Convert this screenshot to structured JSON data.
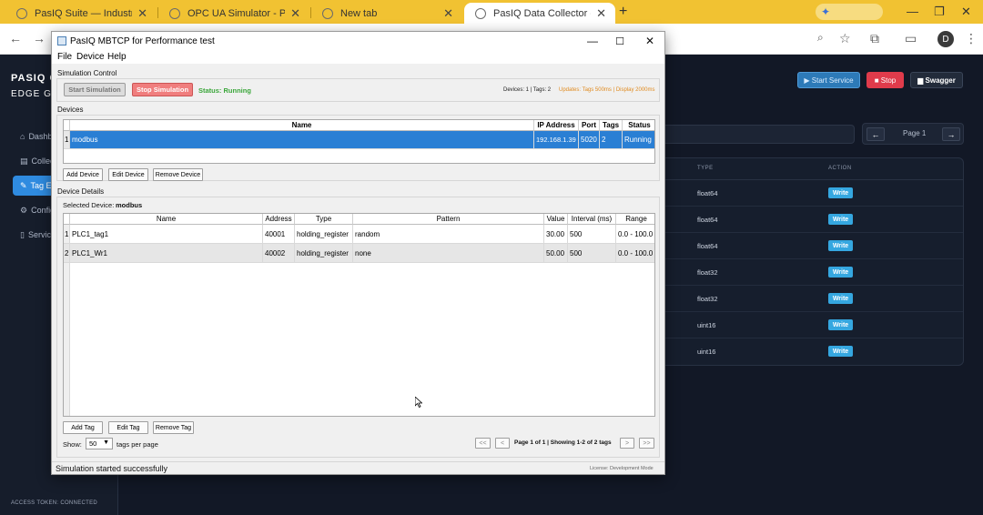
{
  "browser": {
    "tabs": [
      {
        "title": "PasIQ Suite — Industrial Intellig"
      },
      {
        "title": "OPC UA Simulator - Premium D"
      },
      {
        "title": "New tab"
      },
      {
        "title": "PasIQ Data Collector - Edge Ma"
      }
    ],
    "profile_initial": "D"
  },
  "webapp": {
    "brand": "PASIQ CO",
    "brand_sub": "EDGE GAT",
    "nav": [
      "Dashb",
      "Collect",
      "Tag Ex",
      "Config",
      "Servic"
    ],
    "nav_icons": [
      "home-icon",
      "folder-icon",
      "tag-icon",
      "gear-icon",
      "file-icon"
    ],
    "token": "ACCESS TOKEN: CONNECTED",
    "buttons": {
      "start": "▶ Start Service",
      "stop": "■ Stop",
      "swagger": "▆ Swagger"
    },
    "pager": {
      "prev": "←",
      "label": "Page 1",
      "next": "→"
    },
    "table": {
      "headers": {
        "type": "TYPE",
        "action": "ACTION"
      },
      "rows": [
        {
          "type": "float64",
          "action": "Write"
        },
        {
          "type": "float64",
          "action": "Write"
        },
        {
          "type": "float64",
          "action": "Write"
        },
        {
          "type": "float32",
          "action": "Write"
        },
        {
          "type": "float32",
          "action": "Write"
        },
        {
          "type": "uint16",
          "action": "Write"
        },
        {
          "type": "uint16",
          "action": "Write"
        }
      ]
    }
  },
  "window": {
    "title": "PasIQ MBTCP for Performance test",
    "menu": [
      "File",
      "Device",
      "Help"
    ],
    "simulation": {
      "group": "Simulation Control",
      "start": "Start Simulation",
      "stop": "Stop Simulation",
      "status": "Status: Running",
      "counts": "Devices: 1 | Tags: 2",
      "updates": "Updates: Tags 500ms | Display 2000ms"
    },
    "devices": {
      "group": "Devices",
      "headers": {
        "name": "Name",
        "ip": "IP Address",
        "port": "Port",
        "tags": "Tags",
        "status": "Status"
      },
      "rows": [
        {
          "index": "1",
          "name": "modbus",
          "ip": "192.168.1.39",
          "port": "5020",
          "tags": "2",
          "status": "Running"
        }
      ],
      "buttons": {
        "add": "Add Device",
        "edit": "Edit Device",
        "remove": "Remove Device"
      }
    },
    "details": {
      "group": "Device Details",
      "selected_label": "Selected Device:",
      "selected_value": "modbus",
      "headers": {
        "name": "Name",
        "address": "Address",
        "type": "Type",
        "pattern": "Pattern",
        "value": "Value",
        "interval": "Interval (ms)",
        "range": "Range"
      },
      "rows": [
        {
          "index": "1",
          "name": "PLC1_tag1",
          "address": "40001",
          "type": "holding_register",
          "pattern": "random",
          "value": "30.00",
          "interval": "500",
          "range": "0.0 - 100.0"
        },
        {
          "index": "2",
          "name": "PLC1_Wr1",
          "address": "40002",
          "type": "holding_register",
          "pattern": "none",
          "value": "50.00",
          "interval": "500",
          "range": "0.0 - 100.0"
        }
      ],
      "buttons": {
        "add": "Add Tag",
        "edit": "Edit Tag",
        "remove": "Remove Tag"
      },
      "show_label": "Show:",
      "per_page": "50",
      "per_page_suffix": "tags per page",
      "paging": {
        "first": "<<",
        "prev": "<",
        "info": "Page 1 of 1 | Showing 1-2 of 2 tags",
        "next": ">",
        "last": ">>"
      }
    },
    "status_message": "Simulation started successfully",
    "license": "License: Development Mode"
  }
}
